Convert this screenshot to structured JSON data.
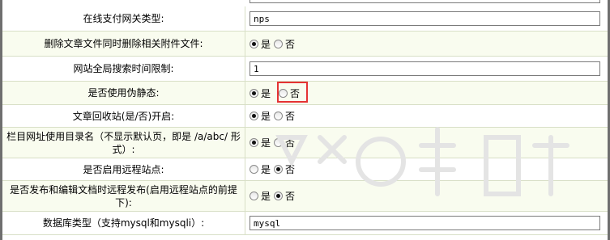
{
  "rows": [
    {
      "label": "在线支付网关类型:",
      "type": "text",
      "value": "nps"
    },
    {
      "label": "删除文章文件同时删除相关附件文件:",
      "type": "radio",
      "selected": "yes"
    },
    {
      "label": "网站全局搜索时间限制:",
      "type": "text",
      "value": "1"
    },
    {
      "label": "是否使用伪静态:",
      "type": "radio",
      "selected": "yes",
      "highlight_no": true
    },
    {
      "label": "文章回收站(是/否)开启:",
      "type": "radio",
      "selected": "yes"
    },
    {
      "label": "栏目网址使用目录名（不显示默认页，即是 /a/abc/ 形式）:",
      "type": "radio",
      "selected": "yes"
    },
    {
      "label": "是否启用远程站点:",
      "type": "radio",
      "selected": "no"
    },
    {
      "label": "是否发布和编辑文档时远程发布(启用远程站点的前提下):",
      "type": "radio",
      "selected": "no"
    },
    {
      "label": "数据库类型（支持mysql和mysqli）:",
      "type": "text",
      "value": "mysql"
    }
  ],
  "radio_labels": {
    "yes": "是",
    "no": "否"
  },
  "colors": {
    "alt_row": "#f9fcef",
    "border": "#d8dfc6",
    "highlight": "#e53333"
  }
}
